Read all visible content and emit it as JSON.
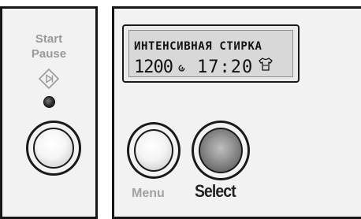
{
  "start_pause": {
    "label_line1": "Start",
    "label_line2": "Pause",
    "icon": "start-pause-diamond-icon"
  },
  "display": {
    "program_name": "ИНТЕНСИВНАЯ СТИРКА",
    "spin_speed": "1200",
    "spin_icon": "spin-icon",
    "time": "17:20",
    "garment_icon": "shirt-icon"
  },
  "buttons": {
    "menu_label": "Menu",
    "select_label": "Select"
  },
  "colors": {
    "panel": "#f2f2f2",
    "border": "#161616",
    "inactive_label": "#9a9a9a",
    "active_label": "#222222",
    "lcd": "#d8d8d8"
  }
}
